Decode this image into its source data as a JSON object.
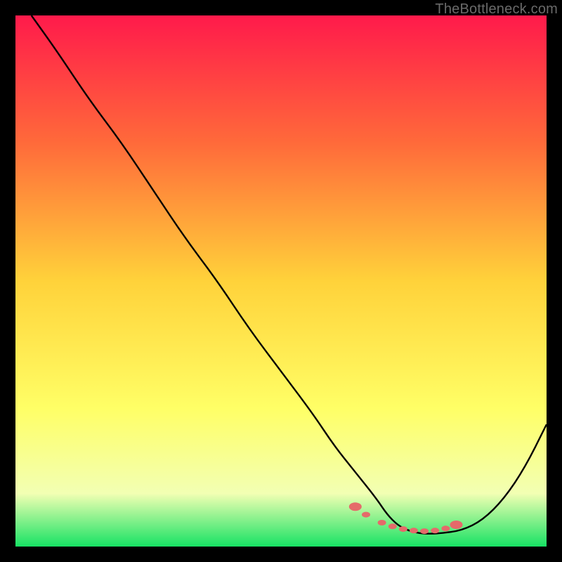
{
  "watermark": "TheBottleneck.com",
  "gradient": {
    "top": "#ff1a4b",
    "mid_upper": "#ff6a3a",
    "mid": "#ffd23a",
    "mid_lower": "#ffff66",
    "lower": "#f2ffb3",
    "bottom": "#17e264"
  },
  "chart_data": {
    "type": "line",
    "title": "",
    "xlabel": "",
    "ylabel": "",
    "xlim": [
      0,
      100
    ],
    "ylim": [
      0,
      100
    ],
    "series": [
      {
        "name": "bottleneck-curve",
        "x": [
          3,
          8,
          14,
          20,
          26,
          32,
          38,
          44,
          50,
          56,
          60,
          64,
          68,
          70,
          72,
          74,
          76,
          78,
          80,
          84,
          88,
          92,
          96,
          100
        ],
        "y": [
          100,
          93,
          84,
          76,
          67,
          58,
          50,
          41,
          33,
          25,
          19,
          14,
          9,
          6,
          4,
          3,
          2.5,
          2.4,
          2.5,
          3,
          5,
          9,
          15,
          23
        ]
      }
    ],
    "markers": {
      "name": "highlight-band",
      "points": [
        {
          "x": 64,
          "y": 7.5
        },
        {
          "x": 66,
          "y": 6.0
        },
        {
          "x": 69,
          "y": 4.5
        },
        {
          "x": 71,
          "y": 3.8
        },
        {
          "x": 73,
          "y": 3.3
        },
        {
          "x": 75,
          "y": 3.0
        },
        {
          "x": 77,
          "y": 2.9
        },
        {
          "x": 79,
          "y": 3.0
        },
        {
          "x": 81,
          "y": 3.4
        },
        {
          "x": 83,
          "y": 4.1
        }
      ],
      "color": "#e56a6a"
    }
  }
}
